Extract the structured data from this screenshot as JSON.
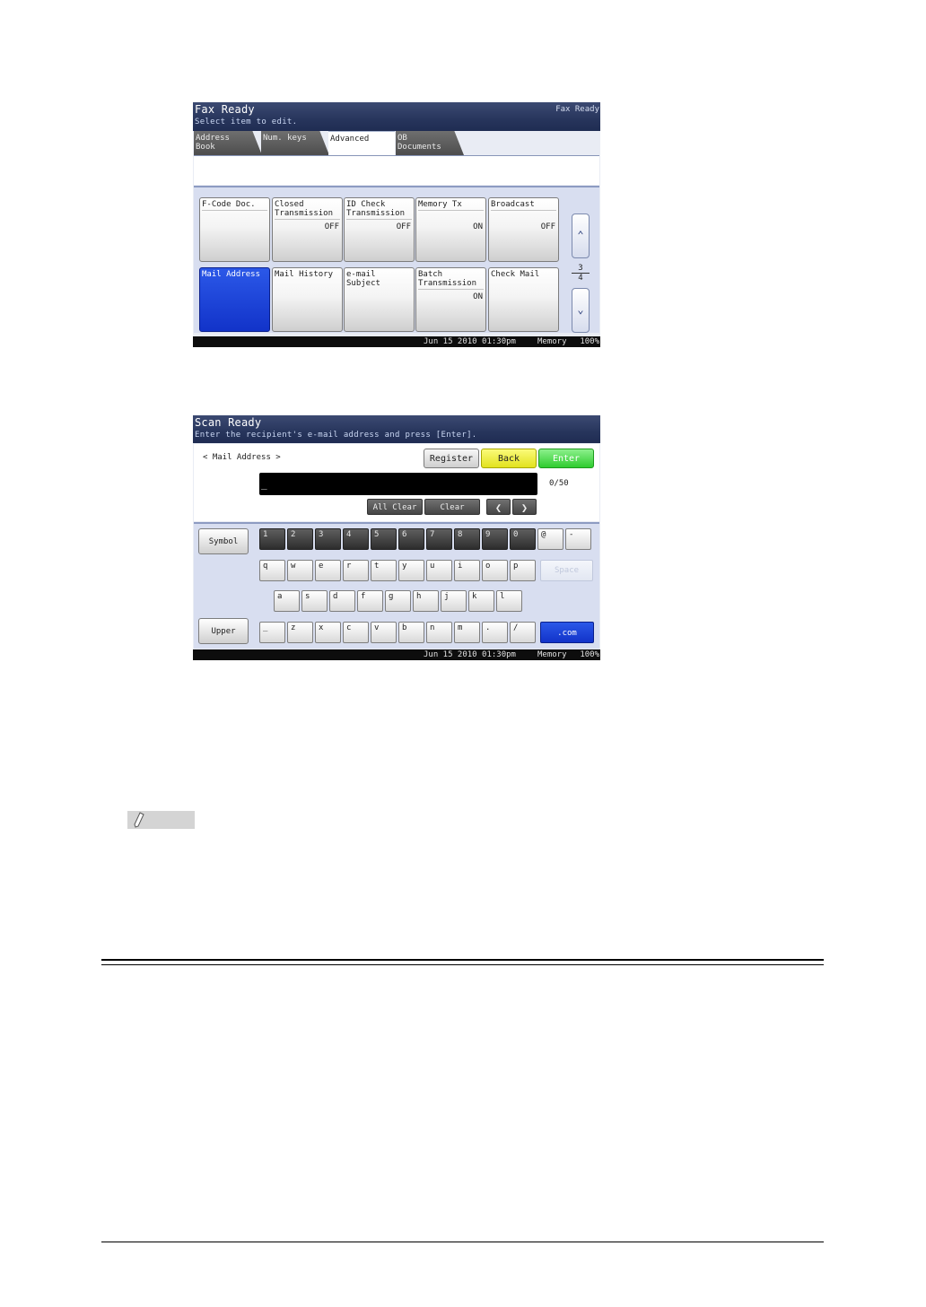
{
  "fax_screen": {
    "title": "Fax Ready",
    "subtitle": "Select item to edit.",
    "status_right": "Fax Ready",
    "tabs": [
      {
        "line1": "Address",
        "line2": "Book"
      },
      {
        "line1": "Num. keys",
        "line2": ""
      },
      {
        "line1": "Advanced",
        "line2": ""
      },
      {
        "line1": "OB",
        "line2": "Documents"
      }
    ],
    "buttons": [
      {
        "label_line1": "F-Code Doc.",
        "label_line2": "",
        "value": ""
      },
      {
        "label_line1": "Closed",
        "label_line2": "Transmission",
        "value": "OFF"
      },
      {
        "label_line1": "ID Check",
        "label_line2": "Transmission",
        "value": "OFF"
      },
      {
        "label_line1": "Memory Tx",
        "label_line2": "",
        "value": "ON"
      },
      {
        "label_line1": "Broadcast",
        "label_line2": "",
        "value": "OFF"
      },
      {
        "label_line1": "Mail Address",
        "label_line2": "",
        "value": ""
      },
      {
        "label_line1": "Mail History",
        "label_line2": "",
        "value": ""
      },
      {
        "label_line1": "e-mail Subject",
        "label_line2": "",
        "value": ""
      },
      {
        "label_line1": "Batch",
        "label_line2": "Transmission",
        "value": "ON"
      },
      {
        "label_line1": "Check Mail",
        "label_line2": "",
        "value": ""
      }
    ],
    "page_current": "3",
    "page_total": "4",
    "footer": {
      "datetime": "Jun 15 2010 01:30pm",
      "memory_label": "Memory",
      "memory_value": "100%"
    }
  },
  "scan_screen": {
    "title": "Scan Ready",
    "subtitle": "Enter the recipient's e-mail address and press [Enter].",
    "field_label": "< Mail Address >",
    "register_label": "Register",
    "back_label": "Back",
    "enter_label": "Enter",
    "input_value": "_",
    "char_count": "0/50",
    "all_clear_label": "All Clear",
    "clear_label": "Clear",
    "symbol_label": "Symbol",
    "upper_label": "Upper",
    "keys_row1": [
      "1",
      "2",
      "3",
      "4",
      "5",
      "6",
      "7",
      "8",
      "9",
      "0",
      "@",
      "-"
    ],
    "keys_row2": [
      "q",
      "w",
      "e",
      "r",
      "t",
      "y",
      "u",
      "i",
      "o",
      "p"
    ],
    "space_label": "Space",
    "keys_row3": [
      "a",
      "s",
      "d",
      "f",
      "g",
      "h",
      "j",
      "k",
      "l"
    ],
    "keys_row4": [
      "_",
      "z",
      "x",
      "c",
      "v",
      "b",
      "n",
      "m",
      ".",
      "/"
    ],
    "dotcom_label": ".com",
    "footer": {
      "datetime": "Jun 15 2010 01:30pm",
      "memory_label": "Memory",
      "memory_value": "100%"
    }
  },
  "colors": {
    "header_navy": "#27355c",
    "selected_blue": "#1233c9",
    "back_yellow": "#e2e21e",
    "enter_green": "#2fcc2f"
  }
}
